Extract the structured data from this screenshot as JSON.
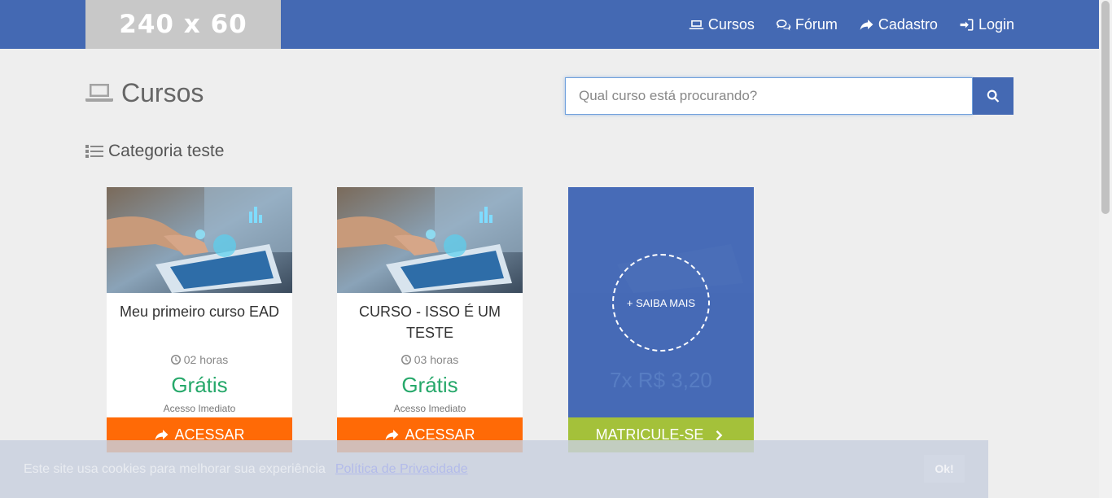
{
  "logo": {
    "text": "240 x 60"
  },
  "nav": {
    "items": [
      {
        "label": "Cursos",
        "icon": "laptop-icon"
      },
      {
        "label": "Fórum",
        "icon": "comments-icon"
      },
      {
        "label": "Cadastro",
        "icon": "share-arrow-icon"
      },
      {
        "label": "Login",
        "icon": "sign-in-icon"
      }
    ]
  },
  "page": {
    "title": "Cursos"
  },
  "search": {
    "placeholder": "Qual curso está procurando?"
  },
  "category": {
    "title": "Categoria teste"
  },
  "courses": [
    {
      "title": "Meu primeiro curso EAD",
      "hours": "02 horas",
      "price": "Grátis",
      "access": "Acesso Imediato",
      "button": "ACESSAR"
    },
    {
      "title": "CURSO - ISSO É UM TESTE",
      "hours": "03 horas",
      "price": "Grátis",
      "access": "Acesso Imediato",
      "button": "ACESSAR"
    }
  ],
  "promo_card": {
    "more": "+ SAIBA MAIS",
    "price": "7x R$ 3,20",
    "button": "MATRICULE-SE"
  },
  "cookie": {
    "text": "Este site usa cookies para melhorar sua experiência",
    "link": "Política de Privacidade",
    "ok": "Ok!"
  },
  "colors": {
    "brand": "#4469b3",
    "orange": "#ff6a06",
    "green_button": "#a4c13a",
    "price": "#26a86a"
  }
}
